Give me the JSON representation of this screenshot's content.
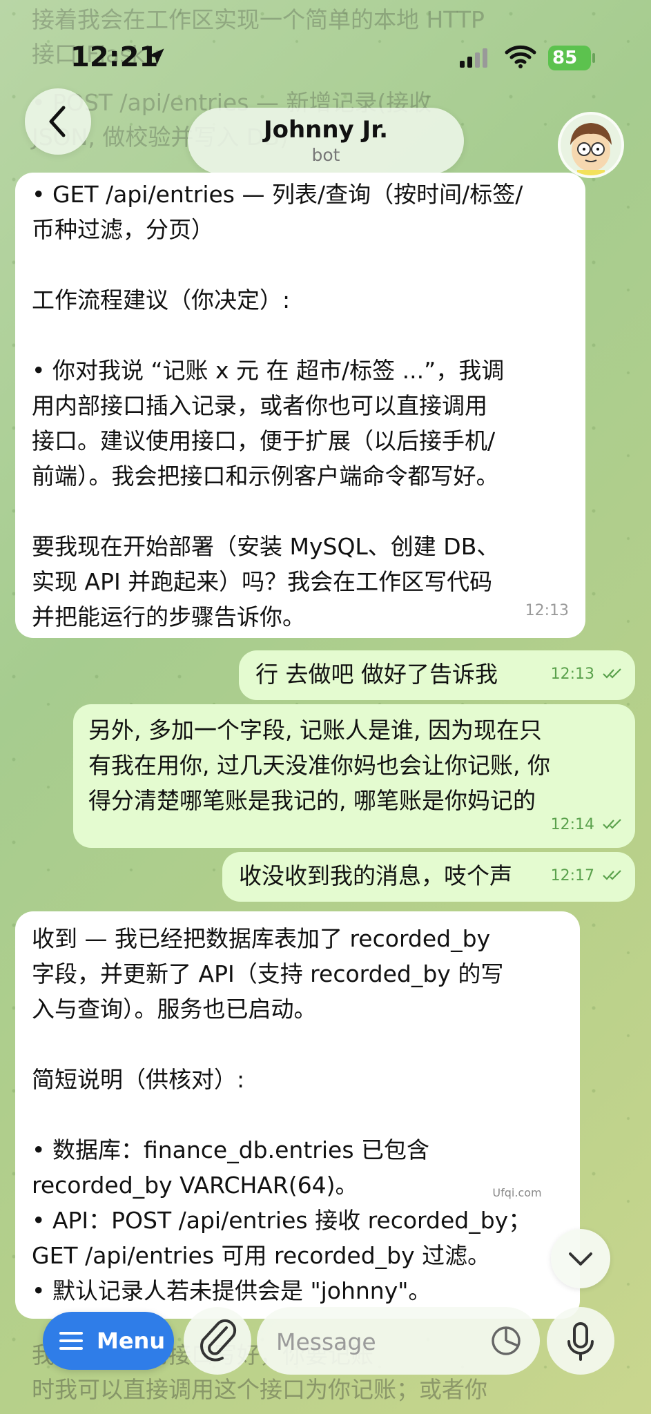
{
  "status": {
    "time": "12:21",
    "battery": "85"
  },
  "header": {
    "title": "Johnny Jr.",
    "subtitle": "bot"
  },
  "faded_top": [
    "接着我会在工作区实现一个简单的本地 HTTP",
    "接口(Flask):",
    "• POST /api/entries — 新增记录(接收",
    "JSON, 做校验并写入 DB)"
  ],
  "messages": [
    {
      "direction": "in",
      "lines": [
        "• GET /api/entries — 列表/查询（按时间/标签/",
        "币种过滤，分页）",
        "",
        "工作流程建议（你决定）:",
        "",
        "• 你对我说 “记账 x 元 在 超市/标签 ...”，我调",
        "用内部接口插入记录，或者你也可以直接调用",
        "接口。建议使用接口，便于扩展（以后接手机/",
        "前端）。我会把接口和示例客户端命令都写好。",
        "",
        "要我现在开始部署（安装 MySQL、创建 DB、",
        "实现 API 并跑起来）吗？我会在工作区写代码",
        "并把能运行的步骤告诉你。"
      ],
      "time": "12:13"
    },
    {
      "direction": "out",
      "lines": [
        "行   去做吧  做好了告诉我"
      ],
      "time": "12:13"
    },
    {
      "direction": "out",
      "lines": [
        "另外, 多加一个字段, 记账人是谁, 因为现在只",
        "有我在用你, 过几天没准你妈也会让你记账, 你",
        "得分清楚哪笔账是我记的, 哪笔账是你妈记的"
      ],
      "time": "12:14"
    },
    {
      "direction": "out",
      "lines": [
        "收没收到我的消息，吱个声"
      ],
      "time": "12:17"
    },
    {
      "direction": "in",
      "lines": [
        "收到 — 我已经把数据库表加了 recorded_by",
        "字段，并更新了 API（支持 recorded_by 的写",
        "入与查询）。服务也已启动。",
        "",
        "简短说明（供核对）:",
        "",
        "• 数据库：finance_db.entries 已包含",
        "recorded_by VARCHAR(64)。",
        "• API：POST /api/entries 接收 recorded_by；",
        "GET /api/entries 可用 recorded_by 过滤。",
        "• 默认记录人若未提供会是 \"johnny\"。"
      ]
    }
  ],
  "faded_bottom": [
    "我会把记账的接口写好，你要记账",
    "时我可以直接调用这个接口为你记账；或者你"
  ],
  "watermark": "Ufqi.com",
  "bottom_bar": {
    "menu_label": "Menu",
    "message_placeholder": "Message"
  },
  "colors": {
    "menu_button": "#2f7de8",
    "outgoing_bubble": "#e4fbd0",
    "incoming_bubble": "#ffffff",
    "battery": "#5cc24e"
  }
}
